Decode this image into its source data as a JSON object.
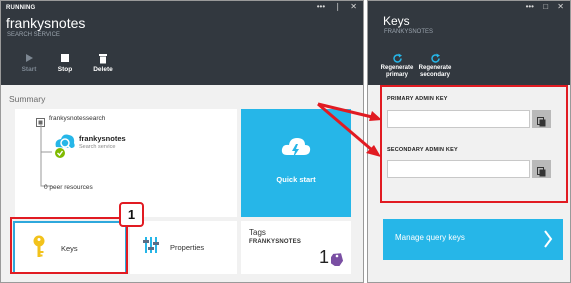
{
  "left_blade": {
    "status": "RUNNING",
    "title": "frankysnotes",
    "subtitle": "SEARCH SERVICE",
    "commands": [
      {
        "label": "Start",
        "icon": "play-icon",
        "enabled": false
      },
      {
        "label": "Stop",
        "icon": "stop-icon",
        "enabled": true
      },
      {
        "label": "Delete",
        "icon": "trash-icon",
        "enabled": true
      }
    ],
    "summary_label": "Summary",
    "resource": {
      "name": "frankysnotessearch",
      "service_name": "frankysnotes",
      "service_type": "Search service",
      "peer_resources": "0 peer resources"
    },
    "quick_start_label": "Quick start",
    "keys_label": "Keys",
    "properties_label": "Properties",
    "tags": {
      "title": "Tags",
      "name": "FRANKYSNOTES",
      "count": "1"
    }
  },
  "right_blade": {
    "title": "Keys",
    "subtitle": "FRANKYSNOTES",
    "commands": [
      {
        "label_line1": "Regenerate",
        "label_line2": "primary",
        "icon": "refresh-icon"
      },
      {
        "label_line1": "Regenerate",
        "label_line2": "secondary",
        "icon": "refresh-icon"
      }
    ],
    "primary_label": "PRIMARY ADMIN KEY",
    "primary_value": "",
    "secondary_label": "SECONDARY ADMIN KEY",
    "secondary_value": "",
    "manage_label": "Manage query keys"
  },
  "callout_number": "1",
  "colors": {
    "header_bg": "#32383f",
    "accent_blue": "#26b6e8",
    "callout_red": "#e11b22",
    "key_yellow": "#f2c21b",
    "tag_purple": "#7a4fa3",
    "check_green": "#7fba00"
  }
}
